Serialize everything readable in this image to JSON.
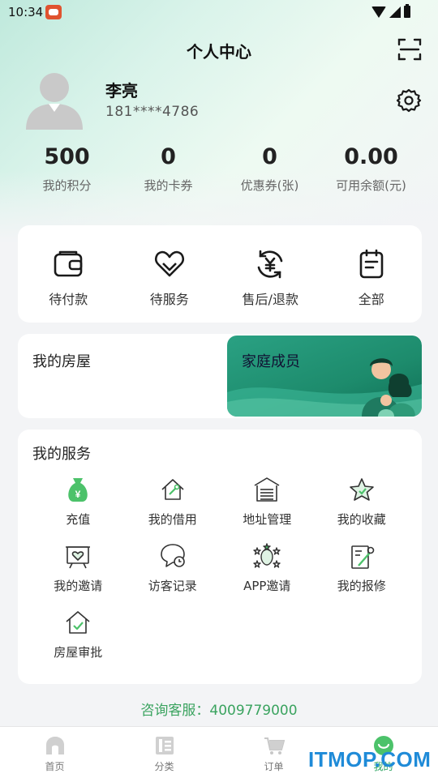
{
  "status_bar": {
    "time": "10:34"
  },
  "header": {
    "title": "个人中心"
  },
  "user": {
    "name": "李亮",
    "phone": "181****4786"
  },
  "stats": [
    {
      "value": "500",
      "label": "我的积分"
    },
    {
      "value": "0",
      "label": "我的卡券"
    },
    {
      "value": "0",
      "label": "优惠券(张)"
    },
    {
      "value": "0.00",
      "label": "可用余额(元)"
    }
  ],
  "orders": [
    {
      "label": "待付款",
      "icon": "wallet-icon"
    },
    {
      "label": "待服务",
      "icon": "heart-icon"
    },
    {
      "label": "售后/退款",
      "icon": "refund-icon"
    },
    {
      "label": "全部",
      "icon": "clipboard-icon"
    }
  ],
  "house": {
    "label": "我的房屋",
    "family_label": "家庭成员"
  },
  "services": {
    "title": "我的服务",
    "items": [
      {
        "label": "充值",
        "icon": "money-bag-icon"
      },
      {
        "label": "我的借用",
        "icon": "house-tools-icon"
      },
      {
        "label": "地址管理",
        "icon": "garage-icon"
      },
      {
        "label": "我的收藏",
        "icon": "star-icon"
      },
      {
        "label": "我的邀请",
        "icon": "invite-board-icon"
      },
      {
        "label": "访客记录",
        "icon": "chat-clock-icon"
      },
      {
        "label": "APP邀请",
        "icon": "sparkle-icon"
      },
      {
        "label": "我的报修",
        "icon": "repair-icon"
      },
      {
        "label": "房屋审批",
        "icon": "house-check-icon"
      }
    ]
  },
  "hotline": "咨询客服：4009779000",
  "tabs": [
    {
      "label": "首页"
    },
    {
      "label": "分类"
    },
    {
      "label": "订单"
    },
    {
      "label": "我的"
    }
  ],
  "watermark": "ITMOP.COM",
  "colors": {
    "accent": "#2aa35f",
    "banner": "#1d8b6c",
    "hotline": "#3aa35f"
  }
}
